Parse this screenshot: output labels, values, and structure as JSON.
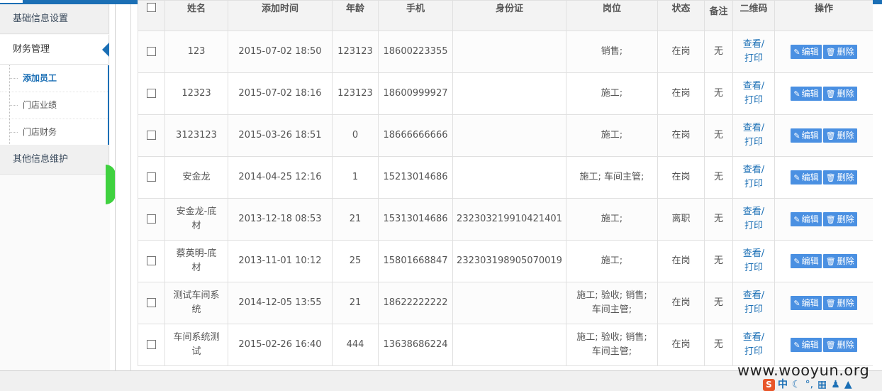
{
  "sidebar": {
    "groups": [
      {
        "label": "基础信息设置"
      },
      {
        "label": "财务管理"
      },
      {
        "label": "其他信息维护"
      }
    ],
    "subitems": [
      {
        "label": "添加员工"
      },
      {
        "label": "门店业绩"
      },
      {
        "label": "门店财务"
      }
    ]
  },
  "table": {
    "headers": {
      "name": "姓名",
      "added": "添加时间",
      "age": "年龄",
      "phone": "手机",
      "idcard": "身份证",
      "position": "岗位",
      "status": "状态",
      "note": "备注",
      "qrcode": "二维码",
      "ops": "操作"
    },
    "qr_label_1": "查看/",
    "qr_label_2": "打印",
    "edit_label": "编辑",
    "delete_label": "删除",
    "rows": [
      {
        "name_1": "123",
        "name_2": "",
        "added": "2015-07-02 18:50",
        "age": "123123",
        "phone": "18600223355",
        "idcard": "",
        "position_1": "销售;",
        "position_2": "",
        "status": "在岗",
        "note": "无"
      },
      {
        "name_1": "12323",
        "name_2": "",
        "added": "2015-07-02 18:16",
        "age": "123123",
        "phone": "18600999927",
        "idcard": "",
        "position_1": "施工;",
        "position_2": "",
        "status": "在岗",
        "note": "无"
      },
      {
        "name_1": "3123123",
        "name_2": "",
        "added": "2015-03-26 18:51",
        "age": "0",
        "phone": "18666666666",
        "idcard": "",
        "position_1": "施工;",
        "position_2": "",
        "status": "在岗",
        "note": "无"
      },
      {
        "name_1": "安金龙",
        "name_2": "",
        "added": "2014-04-25 12:16",
        "age": "1",
        "phone": "15213014686",
        "idcard": "",
        "position_1": "施工; 车间主管;",
        "position_2": "",
        "status": "在岗",
        "note": "无"
      },
      {
        "name_1": "安金龙-底",
        "name_2": "材",
        "added": "2013-12-18 08:53",
        "age": "21",
        "phone": "15313014686",
        "idcard": "232303219910421401",
        "position_1": "施工;",
        "position_2": "",
        "status": "离职",
        "note": "无"
      },
      {
        "name_1": "蔡英明-底",
        "name_2": "材",
        "added": "2013-11-01 10:12",
        "age": "25",
        "phone": "15801668847",
        "idcard": "232303198905070019",
        "position_1": "施工;",
        "position_2": "",
        "status": "在岗",
        "note": "无"
      },
      {
        "name_1": "测试车间系",
        "name_2": "统",
        "added": "2014-12-05 13:55",
        "age": "21",
        "phone": "18622222222",
        "idcard": "",
        "position_1": "施工; 验收; 销售;",
        "position_2": "车间主管;",
        "status": "在岗",
        "note": "无"
      },
      {
        "name_1": "车间系统测",
        "name_2": "试",
        "added": "2015-02-26 16:40",
        "age": "444",
        "phone": "13638686224",
        "idcard": "",
        "position_1": "施工; 验收; 销售;",
        "position_2": "车间主管;",
        "status": "在岗",
        "note": "无"
      }
    ]
  },
  "watermark": "www.wooyun.org",
  "ime": {
    "logo": "S",
    "mode": "中"
  }
}
